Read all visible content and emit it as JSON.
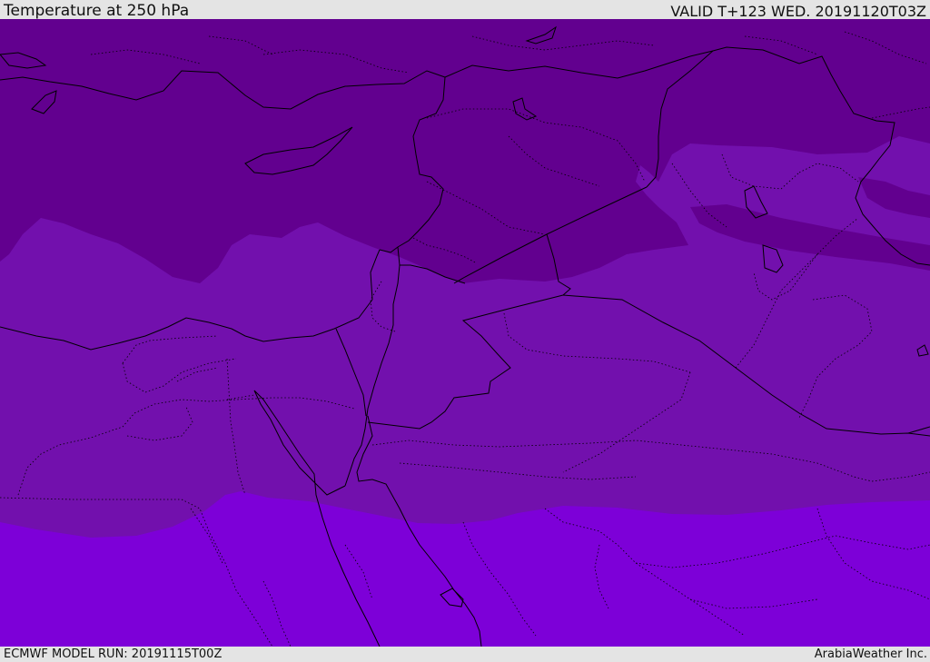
{
  "header": {
    "title": "Temperature at 250 hPa",
    "valid_time": "VALID T+123 WED. 20191120T03Z"
  },
  "footer": {
    "model_run": "ECMWF MODEL RUN: 20191115T00Z",
    "credit": "ArabiaWeather Inc."
  },
  "map": {
    "variable": "Temperature",
    "level": "250 hPa",
    "colors": {
      "coldest_band": "#62008f",
      "middle_band": "#7210ad",
      "warmest_band": "#7d00d8",
      "border": "#000000"
    }
  }
}
